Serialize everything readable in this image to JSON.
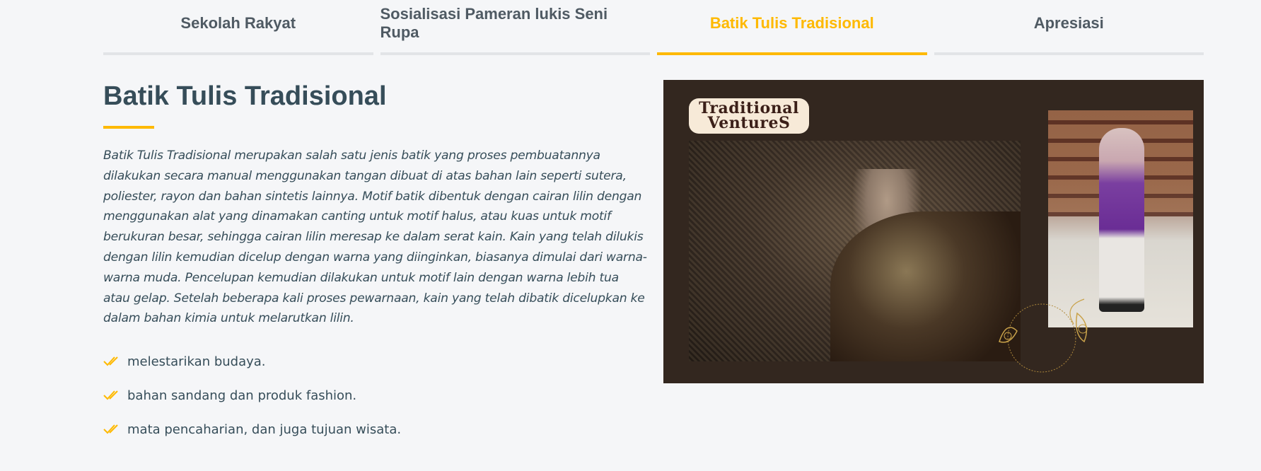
{
  "tabs": [
    {
      "label": "Sekolah Rakyat",
      "active": false
    },
    {
      "label": "Sosialisasi Pameran lukis Seni Rupa",
      "active": false
    },
    {
      "label": "Batik Tulis Tradisional",
      "active": true
    },
    {
      "label": "Apresiasi",
      "active": false
    }
  ],
  "content": {
    "title": "Batik Tulis Tradisional",
    "description": "Batik Tulis Tradisional merupakan salah satu jenis batik yang proses pembuatannya dilakukan secara manual menggunakan tangan dibuat di atas bahan lain seperti sutera, poliester, rayon dan bahan sintetis lainnya. Motif batik dibentuk dengan cairan lilin dengan menggunakan alat yang dinamakan canting untuk motif halus, atau kuas untuk motif berukuran besar, sehingga cairan lilin meresap ke dalam serat kain. Kain yang telah dilukis dengan lilin kemudian dicelup dengan warna yang diinginkan, biasanya dimulai dari warna-warna muda. Pencelupan kemudian dilakukan untuk motif lain dengan warna lebih tua atau gelap. Setelah beberapa kali proses pewarnaan, kain yang telah dibatik dicelupkan ke dalam bahan kimia untuk melarutkan lilin.",
    "checklist": [
      "melestarikan budaya.",
      "bahan sandang dan produk fashion.",
      "mata pencaharian, dan juga tujuan wisata."
    ]
  },
  "image": {
    "logo_line1": "Traditional",
    "logo_line2": "VentureS"
  },
  "colors": {
    "accent": "#feb900",
    "text": "#364d59",
    "panel_bg": "#33271f"
  }
}
